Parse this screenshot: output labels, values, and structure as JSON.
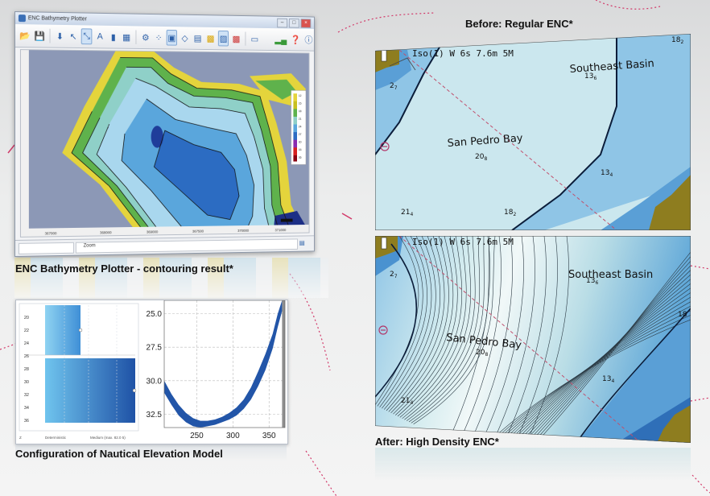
{
  "captions": {
    "before": "Before: Regular ENC*",
    "after": "After: High Density ENC*",
    "plotter": "ENC Bathymetry Plotter - contouring result*",
    "config": "Configuration of Nautical Elevation Model"
  },
  "app": {
    "title": "ENC Bathymetry Plotter",
    "status_label": "Zoom",
    "toolbar_icons": [
      "open-icon",
      "save-icon",
      "import-icon",
      "pointer-icon",
      "zoom-icon",
      "text-icon",
      "chart-icon",
      "grid-icon",
      "settings-icon",
      "points-icon",
      "3d-icon",
      "layer-icon",
      "page-icon",
      "palette-icon",
      "contour-icon",
      "export-icon",
      "window-icon",
      "signal-icon",
      "help-icon",
      "info-icon"
    ],
    "legend_values": [
      "12",
      "15",
      "18",
      "21",
      "24",
      "27",
      "30",
      "33",
      "36"
    ],
    "axis_x_labels": [
      "367000",
      "368000",
      "369000",
      "367500",
      "370000",
      "371000"
    ]
  },
  "config_panel": {
    "left_ticks": [
      "20",
      "22",
      "24",
      "26",
      "28",
      "30",
      "32",
      "34",
      "36"
    ],
    "footer_left": "Z",
    "footer_mid": "Deterministic",
    "footer_right": "Medium (max. 82.0 5)",
    "chart_data": {
      "type": "area",
      "x_ticks": [
        "250",
        "300",
        "350"
      ],
      "y_ticks": [
        "25.0",
        "27.5",
        "30.0",
        "32.5"
      ],
      "xlim": [
        205,
        372
      ],
      "ylim": [
        33.5,
        24
      ],
      "grid": true,
      "series": [
        {
          "x": [
            205,
            215,
            225,
            235,
            245,
            255,
            265,
            275,
            285,
            295,
            305,
            315,
            325,
            335,
            345,
            355,
            362,
            368
          ],
          "upper": [
            30.0,
            31.0,
            31.8,
            32.4,
            32.8,
            33.0,
            33.0,
            32.9,
            32.7,
            32.4,
            32.0,
            31.4,
            30.5,
            29.3,
            28.0,
            26.5,
            25.0,
            24.0
          ],
          "lower": [
            30.9,
            31.8,
            32.6,
            33.1,
            33.4,
            33.5,
            33.4,
            33.3,
            33.1,
            32.9,
            32.6,
            32.1,
            31.4,
            30.4,
            29.2,
            27.6,
            26.0,
            24.8
          ]
        }
      ]
    }
  },
  "enc_before": {
    "light_label": "Iso(1) W 6s 7.6m 5M",
    "place_1": "Southeast Basin",
    "place_2": "San Pedro Bay",
    "depths": [
      {
        "t": "18",
        "s": "2"
      },
      {
        "t": "13",
        "s": "6"
      },
      {
        "t": "2",
        "s": "7"
      },
      {
        "t": "20",
        "s": "8"
      },
      {
        "t": "13",
        "s": "4"
      },
      {
        "t": "21",
        "s": "4"
      },
      {
        "t": "18",
        "s": "2"
      }
    ]
  },
  "enc_after": {
    "light_label": "Iso(1) W 6s 7.6m 5M",
    "place_1": "Southeast Basin",
    "place_2": "San Pedro Bay",
    "depths": [
      {
        "t": "2",
        "s": "7"
      },
      {
        "t": "13",
        "s": "6"
      },
      {
        "t": "18",
        "s": ""
      },
      {
        "t": "20",
        "s": "8"
      },
      {
        "t": "13",
        "s": "4"
      },
      {
        "t": "21",
        "s": "4"
      }
    ]
  },
  "colors": {
    "deep": "#2f6fb8",
    "mid": "#8fc5e6",
    "shallow": "#cbe7ee",
    "white": "#eef6f6",
    "land": "#8e7d1f",
    "route": "#c0506d"
  }
}
